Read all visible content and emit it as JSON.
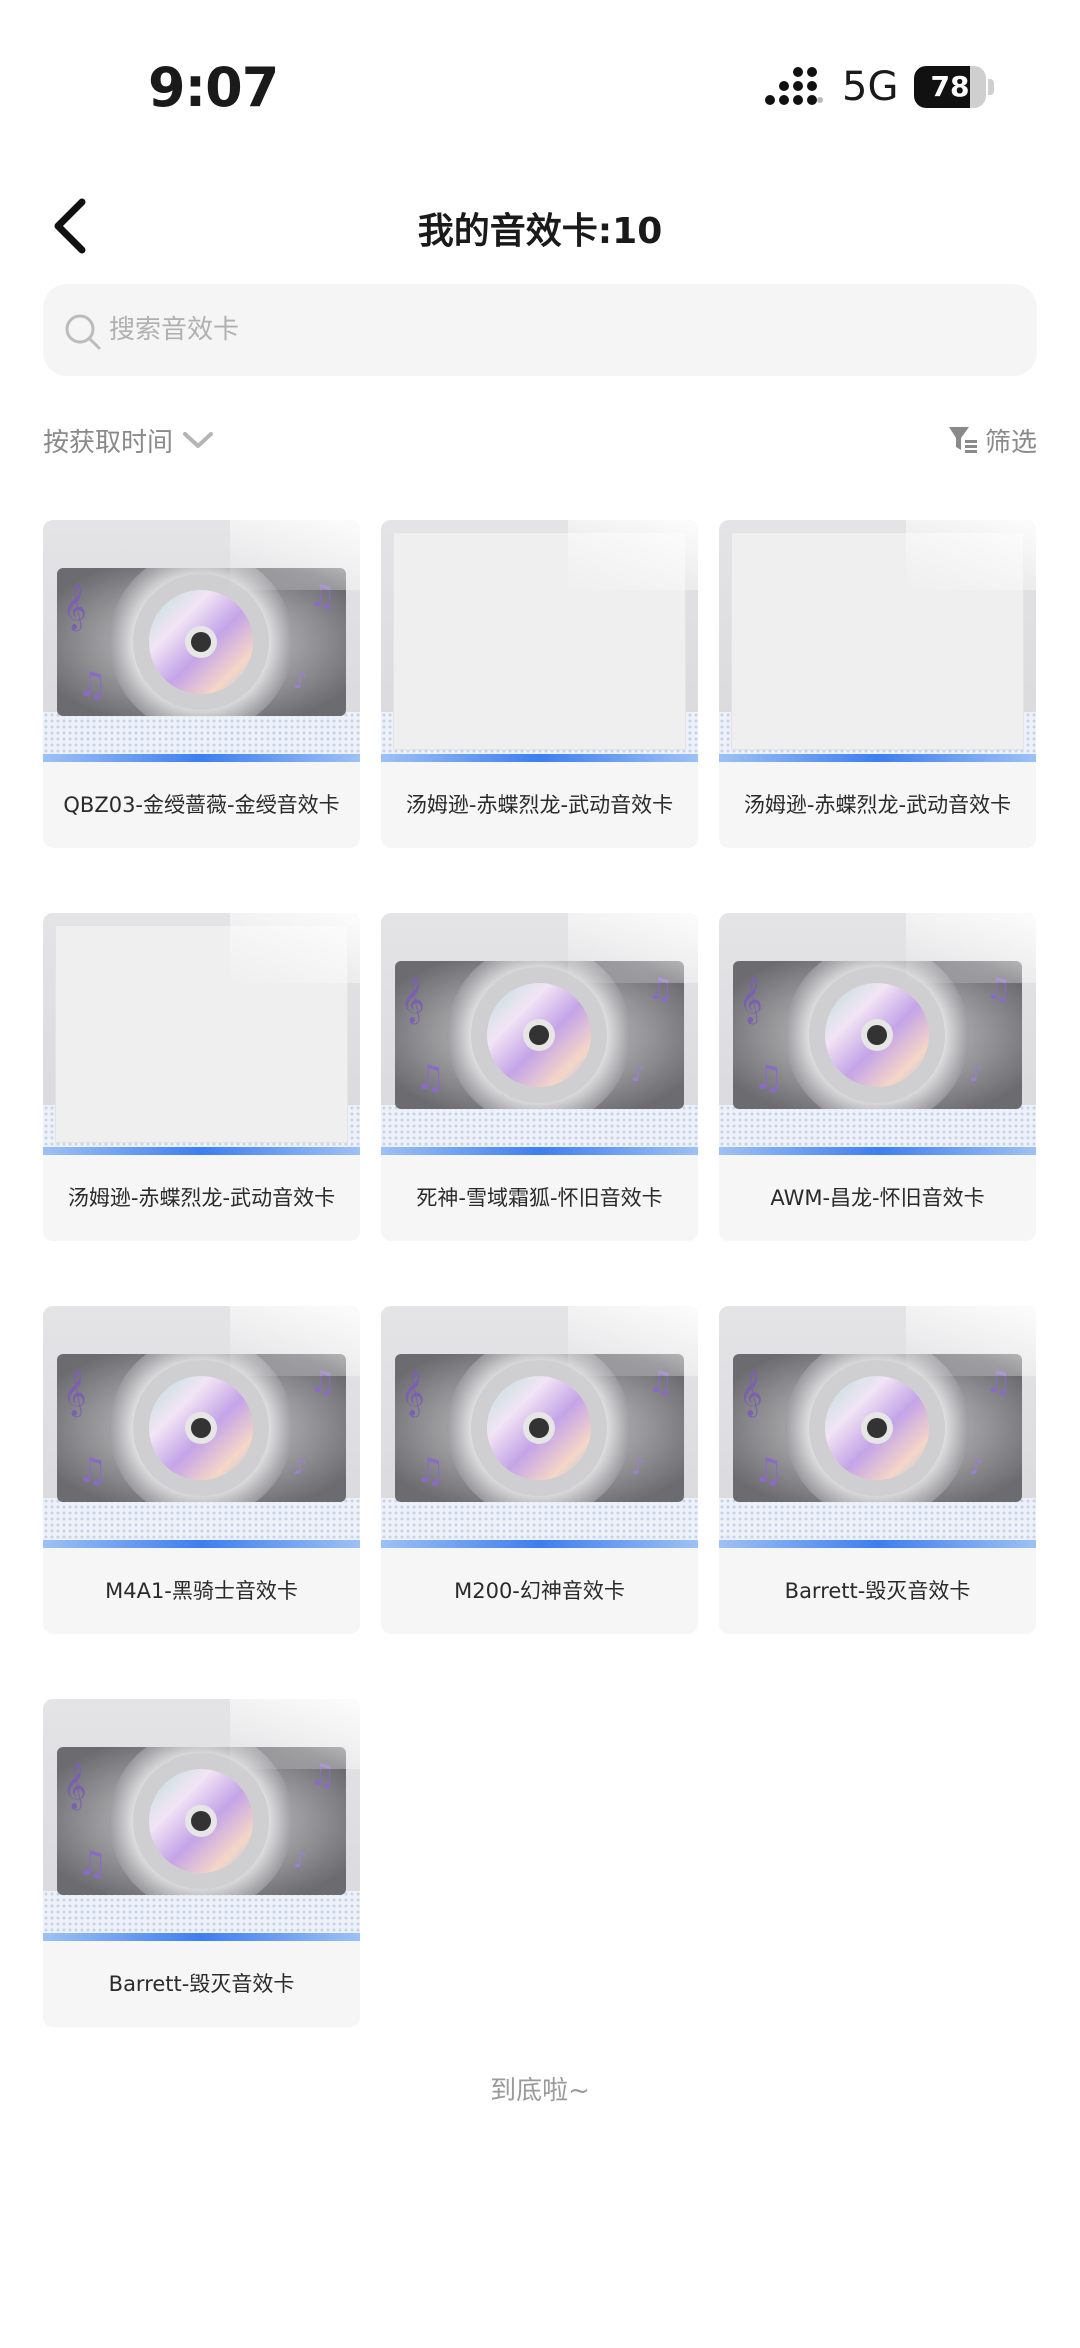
{
  "status_bar": {
    "time": "9:07",
    "network": "5G",
    "battery_percent": "78",
    "battery_level": 0.78
  },
  "header": {
    "back_icon": "chevron-left-icon",
    "title": "我的音效卡:10"
  },
  "search": {
    "icon": "search-icon",
    "placeholder": "搜索音效卡",
    "value": ""
  },
  "sort": {
    "label": "按获取时间",
    "icon": "chevron-down-icon"
  },
  "filter": {
    "label": "筛选",
    "icon": "filter-icon"
  },
  "cards": [
    {
      "label": "QBZ03-金绶蔷薇-金绶音效卡",
      "image": "disc"
    },
    {
      "label": "汤姆逊-赤蝶烈龙-武动音效卡",
      "image": "placeholder"
    },
    {
      "label": "汤姆逊-赤蝶烈龙-武动音效卡",
      "image": "placeholder"
    },
    {
      "label": "汤姆逊-赤蝶烈龙-武动音效卡",
      "image": "placeholder"
    },
    {
      "label": "死神-雪域霜狐-怀旧音效卡",
      "image": "disc"
    },
    {
      "label": "AWM-昌龙-怀旧音效卡",
      "image": "disc"
    },
    {
      "label": "M4A1-黑骑士音效卡",
      "image": "disc"
    },
    {
      "label": "M200-幻神音效卡",
      "image": "disc"
    },
    {
      "label": "Barrett-毁灭音效卡",
      "image": "disc"
    },
    {
      "label": "Barrett-毁灭音效卡",
      "image": "disc"
    }
  ],
  "footer": {
    "end_text": "到底啦~"
  },
  "colors": {
    "accent_blue": "#3d7ef0",
    "card_bg": "#f6f6f6",
    "muted_text": "#8a8a8a"
  }
}
